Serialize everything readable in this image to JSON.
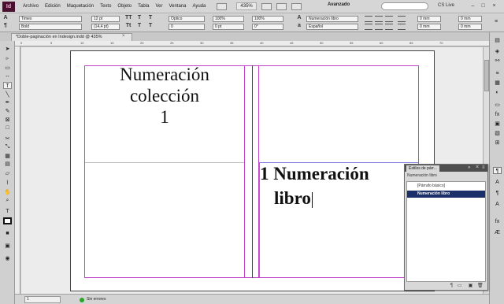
{
  "app": {
    "logo": "Id",
    "menu": [
      "Archivo",
      "Edición",
      "Maquetación",
      "Texto",
      "Objeto",
      "Tabla",
      "Ver",
      "Ventana",
      "Ayuda"
    ],
    "zoom": "435%",
    "workspace": "Avanzado",
    "cs_live": "CS Live"
  },
  "control": {
    "font_family": "Times",
    "font_style": "Bold",
    "font_size": "12 pt",
    "leading": "(14,4 pt)",
    "kerning": "Óptico",
    "tracking": "0",
    "vscale": "100%",
    "hscale": "100%",
    "baseline": "0 pt",
    "skew": "0°",
    "paragraph_style": "Numeración libro",
    "language": "Español",
    "indent_left": "0 mm",
    "indent_right": "0 mm",
    "space_before": "0 mm",
    "space_after": "0 mm"
  },
  "document": {
    "tab_title": "*Doble-paginación en Indesign.indd @ 435%",
    "ruler_numbers": [
      "0",
      "5",
      "10",
      "15",
      "20",
      "25",
      "30",
      "35",
      "40",
      "45",
      "50",
      "55",
      "60",
      "65",
      "70"
    ],
    "left_page_text": [
      "Numeración",
      "colección",
      "1"
    ],
    "right_page_text": [
      "1 Numeración",
      "libro"
    ]
  },
  "status": {
    "page": "1",
    "preflight": "Sin errores"
  },
  "panel": {
    "tab": "Estilos de párr...",
    "current_style": "Numeración libro",
    "items": [
      {
        "label": "[Párrafo básico]",
        "selected": false
      },
      {
        "label": "Numeración libro",
        "selected": true
      }
    ],
    "colors": {
      "selected_bg": "#1b2f6b",
      "selected_fg": "#ffffff"
    }
  }
}
